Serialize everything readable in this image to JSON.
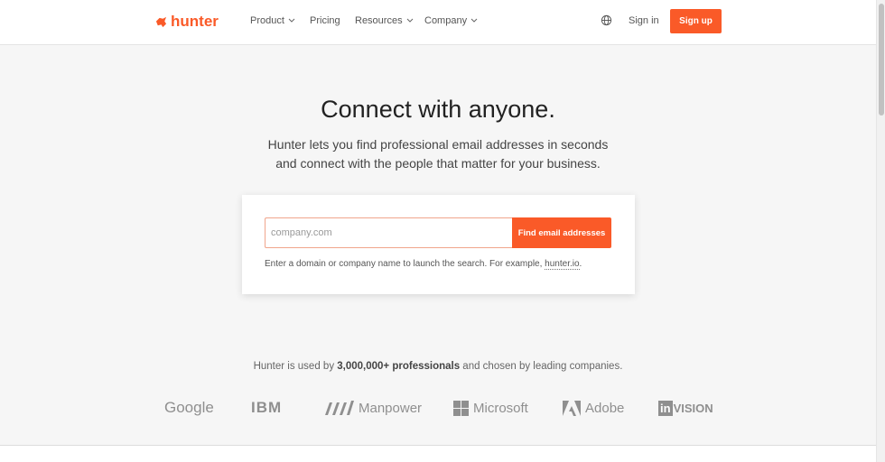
{
  "nav": {
    "brand": "hunter",
    "links": [
      {
        "label": "Product",
        "has_dropdown": true
      },
      {
        "label": "Pricing",
        "has_dropdown": false
      },
      {
        "label": "Resources",
        "has_dropdown": true
      },
      {
        "label": "Company",
        "has_dropdown": true
      }
    ],
    "language_icon": "globe-icon",
    "sign_in": "Sign in",
    "sign_up": "Sign up"
  },
  "hero": {
    "title": "Connect with anyone.",
    "subtitle": "Hunter lets you find professional email addresses in seconds and connect with the people that matter for your business."
  },
  "search": {
    "placeholder": "company.com",
    "value": "",
    "button_label": "Find email addresses",
    "hint_prefix": "Enter a domain or company name to launch the search. For example, ",
    "hint_link": "hunter.io",
    "hint_suffix": "."
  },
  "social_proof": {
    "prefix": "Hunter is used by ",
    "highlight": "3,000,000+ professionals",
    "suffix": " and chosen by leading companies.",
    "logos": [
      "Google",
      "IBM",
      "Manpower",
      "Microsoft",
      "Adobe",
      "in",
      "VISION"
    ]
  },
  "colors": {
    "accent": "#fa5a28",
    "background": "#f6f6f6",
    "logo_gray": "#8f8f8f"
  }
}
